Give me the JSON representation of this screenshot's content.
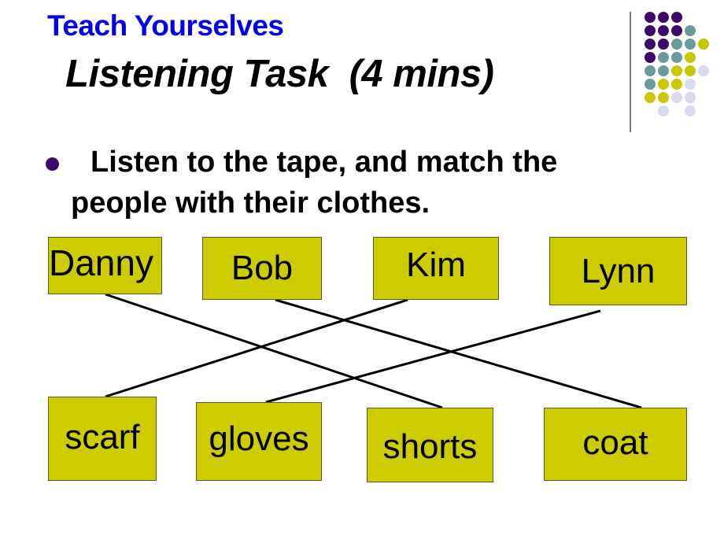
{
  "slide": {
    "subtitle": "Teach Yourselves",
    "title": " Listening Task  (4 mins)",
    "instruction_line1": "Listen to the tape, and match the",
    "instruction_line2": "people with their clothes."
  },
  "colors": {
    "box_fill": "#cccc00",
    "subtitle": "#0000ee",
    "bullet": "#3d0a6b",
    "purple": "#3d0a6b",
    "teal": "#6a9a9a",
    "yellow": "#c8c800",
    "lavender": "#d8d8f0"
  },
  "decor_dots": [
    [
      "P",
      "P",
      "P",
      "",
      ""
    ],
    [
      "P",
      "P",
      "P",
      "T",
      ""
    ],
    [
      "P",
      "P",
      "T",
      "T",
      "Y"
    ],
    [
      "P",
      "T",
      "T",
      "Y",
      ""
    ],
    [
      "T",
      "T",
      "Y",
      "Y",
      "L"
    ],
    [
      "T",
      "Y",
      "Y",
      "L",
      ""
    ],
    [
      "Y",
      "Y",
      "L",
      "L",
      ""
    ],
    [
      "",
      "L",
      "",
      "L",
      ""
    ]
  ],
  "people": [
    {
      "id": "danny",
      "label": "Danny"
    },
    {
      "id": "bob",
      "label": "Bob"
    },
    {
      "id": "kim",
      "label": "Kim"
    },
    {
      "id": "lynn",
      "label": "Lynn"
    }
  ],
  "clothes": [
    {
      "id": "scarf",
      "label": "scarf"
    },
    {
      "id": "gloves",
      "label": "gloves"
    },
    {
      "id": "shorts",
      "label": "shorts"
    },
    {
      "id": "coat",
      "label": "coat"
    }
  ],
  "matches": [
    {
      "person": "danny",
      "clothing": "shorts"
    },
    {
      "person": "bob",
      "clothing": "coat"
    },
    {
      "person": "kim",
      "clothing": "scarf"
    },
    {
      "person": "lynn",
      "clothing": "gloves"
    }
  ]
}
